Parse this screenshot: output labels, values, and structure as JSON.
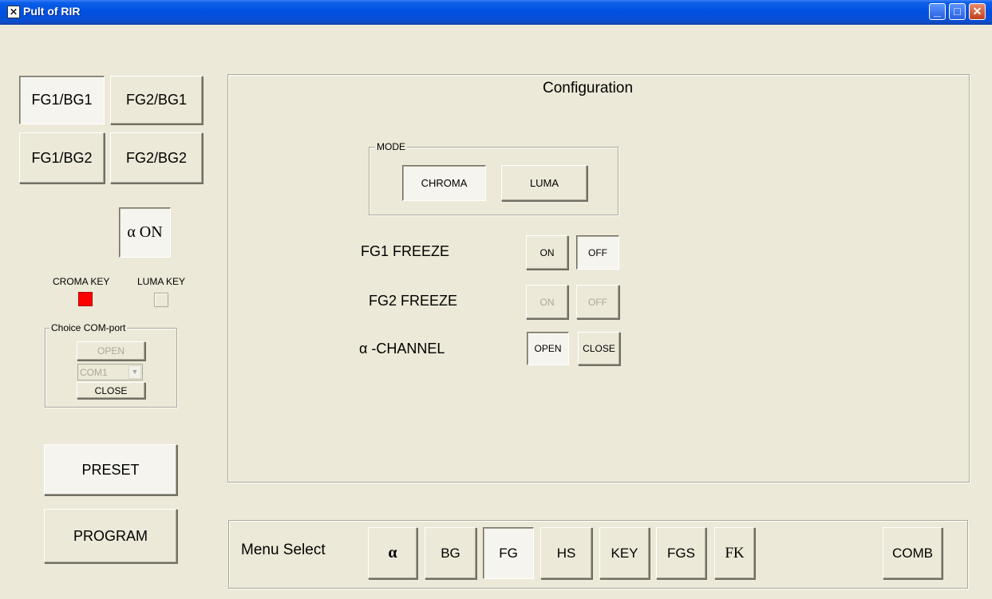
{
  "window": {
    "title": "Pult of RIR",
    "buttons": {
      "minimize": "_",
      "maximize": "□",
      "close": "✕"
    }
  },
  "left_panel": {
    "pair_buttons": [
      "FG1/BG1",
      "FG2/BG1",
      "FG1/BG2",
      "FG2/BG2"
    ],
    "alpha_on_label": "α ON",
    "croma_key_label": "CROMA KEY",
    "luma_key_label": "LUMA KEY",
    "croma_key_color": "#ff0000",
    "luma_key_color": "#ece9d8",
    "com_port": {
      "legend": "Choice COM-port",
      "open_label": "OPEN",
      "port_value": "COM1",
      "close_label": "CLOSE"
    },
    "preset_label": "PRESET",
    "program_label": "PROGRAM"
  },
  "config": {
    "title": "Configuration",
    "mode_legend": "MODE",
    "mode_chroma": "CHROMA",
    "mode_luma": "LUMA",
    "fg1_freeze_label": "FG1 FREEZE",
    "fg1_on": "ON",
    "fg1_off": "OFF",
    "fg2_freeze_label": "FG2 FREEZE",
    "fg2_on": "ON",
    "fg2_off": "OFF",
    "alpha_channel_label": "α -CHANNEL",
    "alpha_open": "OPEN",
    "alpha_close": "CLOSE"
  },
  "menu": {
    "label": "Menu Select",
    "items": [
      "α",
      "BG",
      "FG",
      "HS",
      "KEY",
      "FGS",
      "FK"
    ],
    "comb_label": "COMB"
  }
}
